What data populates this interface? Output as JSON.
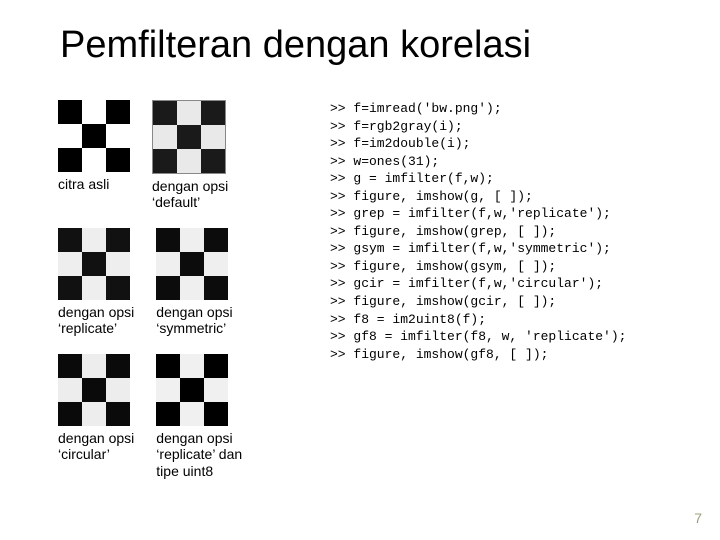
{
  "title": "Pemfilteran dengan korelasi",
  "captions": {
    "orig": "citra asli",
    "default_l1": "dengan opsi",
    "default_l2": "‘default’",
    "replicate_l1": "dengan opsi",
    "replicate_l2": "‘replicate’",
    "symmetric_l1": "dengan opsi",
    "symmetric_l2": "‘symmetric’",
    "circular_l1": "dengan opsi",
    "circular_l2": "‘circular’",
    "uint8_l1": "dengan opsi",
    "uint8_l2": "‘replicate’ dan",
    "uint8_l3": "tipe uint8"
  },
  "code": {
    "lines": [
      ">> f=imread('bw.png');",
      ">> f=rgb2gray(i);",
      ">> f=im2double(i);",
      ">> w=ones(31);",
      ">> g = imfilter(f,w);",
      ">> figure, imshow(g, [ ]);",
      ">> grep = imfilter(f,w,'replicate');",
      ">> figure, imshow(grep, [ ]);",
      ">> gsym = imfilter(f,w,'symmetric');",
      ">> figure, imshow(gsym, [ ]);",
      ">> gcir = imfilter(f,w,'circular');",
      ">> figure, imshow(gcir, [ ]);",
      ">> f8 = im2uint8(f);",
      ">> gf8 = imfilter(f8, w, 'replicate');",
      ">> figure, imshow(gf8, [ ]);"
    ]
  },
  "page_number": "7"
}
